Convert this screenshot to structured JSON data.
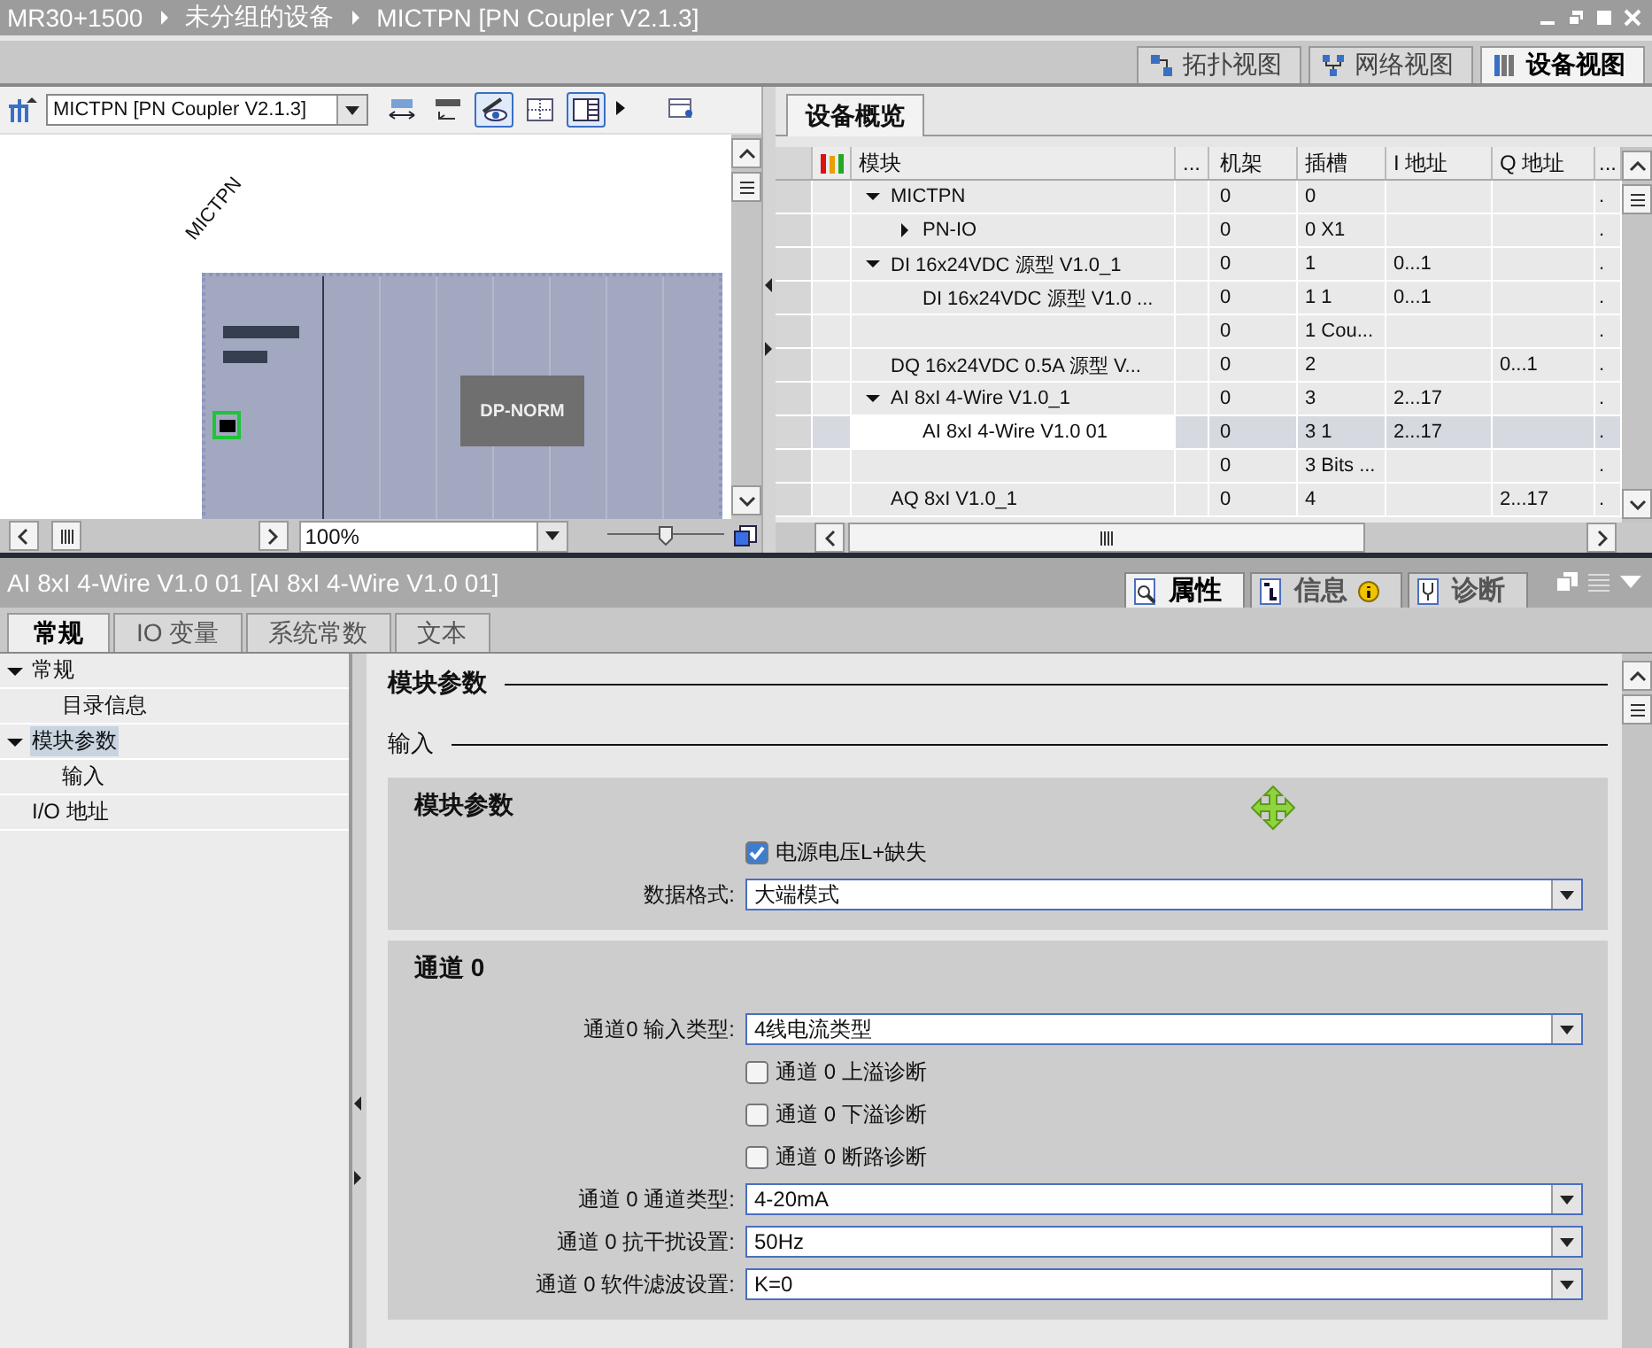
{
  "breadcrumb": [
    "MR30+1500",
    "未分组的设备",
    "MICTPN [PN Coupler V2.1.3]"
  ],
  "view_tabs": [
    {
      "label": "拓扑视图",
      "kind": "topology",
      "selected": false
    },
    {
      "label": "网络视图",
      "kind": "network",
      "selected": false
    },
    {
      "label": "设备视图",
      "kind": "device",
      "selected": true
    }
  ],
  "device_toolbar": {
    "device_select": "MICTPN [PN Coupler V2.1.3]",
    "buttons": [
      {
        "kind": "width",
        "on": false
      },
      {
        "kind": "name",
        "on": false
      },
      {
        "kind": "eye",
        "on": true
      },
      {
        "kind": "grid",
        "on": false
      },
      {
        "kind": "table",
        "on": true
      },
      {
        "kind": "more",
        "on": false
      },
      {
        "kind": "panel",
        "on": false
      }
    ]
  },
  "canvas": {
    "device_label": "MICTPN",
    "module_label": "DP-NORM"
  },
  "zoom": {
    "value": "100%",
    "level": 0.5
  },
  "overview": {
    "tab": "设备概览",
    "columns": [
      "模块",
      "...",
      "机架",
      "插槽",
      "I 地址",
      "Q 地址",
      "..."
    ],
    "rows": [
      {
        "module": "MICTPN",
        "expanded": true,
        "rack": "0",
        "slot": "0",
        "more": ".",
        "selected": false,
        "children": [
          {
            "module": "PN-IO",
            "expanded": false,
            "rack": "0",
            "slot": "0 X1",
            "more": ".",
            "selected": false
          }
        ]
      },
      {
        "module": "DI 16x24VDC 源型 V1.0_1",
        "expanded": true,
        "rack": "0",
        "slot": "1",
        "i_addr": "0...1",
        "more": ".",
        "selected": false,
        "children": [
          {
            "module": "DI 16x24VDC 源型 V1.0 ...",
            "rack": "0",
            "slot": "1 1",
            "i_addr": "0...1",
            "more": ".",
            "selected": false
          },
          {
            "rack": "0",
            "slot": "1 Cou...",
            "more": ".",
            "selected": false
          }
        ]
      },
      {
        "module": "DQ 16x24VDC 0.5A 源型 V...",
        "rack": "0",
        "slot": "2",
        "q_addr": "0...1",
        "more": ".",
        "selected": false
      },
      {
        "module": "AI 8xI 4-Wire V1.0_1",
        "expanded": true,
        "rack": "0",
        "slot": "3",
        "i_addr": "2...17",
        "more": ".",
        "selected": false,
        "children": [
          {
            "module": "AI 8xI 4-Wire V1.0 01",
            "rack": "0",
            "slot": "3 1",
            "i_addr": "2...17",
            "more": ".",
            "selected": true
          },
          {
            "rack": "0",
            "slot": "3 Bits ...",
            "more": ".",
            "selected": false
          }
        ]
      },
      {
        "module": "AQ 8xI V1.0_1",
        "rack": "0",
        "slot": "4",
        "q_addr": "2...17",
        "more": ".",
        "selected": false
      }
    ]
  },
  "inspector": {
    "title": "AI 8xI 4-Wire V1.0 01 [AI 8xI 4-Wire V1.0 01]",
    "panel_tabs": [
      {
        "label": "属性",
        "kind": "properties",
        "badge": false,
        "selected": true
      },
      {
        "label": "信息",
        "kind": "info",
        "badge": true,
        "selected": false
      },
      {
        "label": "诊断",
        "kind": "diagnostics",
        "badge": false,
        "selected": false
      }
    ],
    "tabs": [
      {
        "label": "常规",
        "selected": true
      },
      {
        "label": "IO 变量",
        "selected": false
      },
      {
        "label": "系统常数",
        "selected": false
      },
      {
        "label": "文本",
        "selected": false
      }
    ],
    "nav": [
      {
        "label": "常规",
        "expanded": true,
        "selected": false,
        "children": [
          {
            "label": "目录信息",
            "selected": false
          }
        ]
      },
      {
        "label": "模块参数",
        "expanded": true,
        "selected": true,
        "children": [
          {
            "label": "输入",
            "selected": false
          }
        ]
      },
      {
        "label": "I/O 地址",
        "selected": false
      }
    ],
    "heading": "模块参数",
    "subheading": "输入",
    "sections": [
      {
        "title": "模块参数",
        "rows": [
          {
            "kind": "checkbox",
            "label": "电源电压L+缺失",
            "checked": true
          },
          {
            "kind": "dropdown",
            "label": "数据格式:",
            "value": "大端模式"
          }
        ]
      },
      {
        "title": "通道 0",
        "rows": [
          {
            "kind": "dropdown",
            "label": "通道0 输入类型:",
            "value": "4线电流类型"
          },
          {
            "kind": "checkbox",
            "label": "通道 0 上溢诊断",
            "checked": false
          },
          {
            "kind": "checkbox",
            "label": "通道 0 下溢诊断",
            "checked": false
          },
          {
            "kind": "checkbox",
            "label": "通道 0 断路诊断",
            "checked": false
          },
          {
            "kind": "dropdown",
            "label": "通道 0 通道类型:",
            "value": "4-20mA"
          },
          {
            "kind": "dropdown",
            "label": "通道 0 抗干扰设置:",
            "value": "50Hz"
          },
          {
            "kind": "dropdown",
            "label": "通道 0 软件滤波设置:",
            "value": "K=0"
          }
        ]
      }
    ]
  }
}
